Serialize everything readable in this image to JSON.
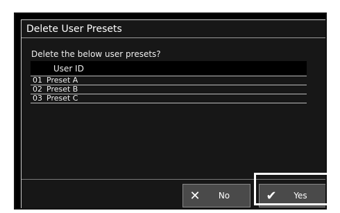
{
  "dialog": {
    "title": "Delete User Presets",
    "prompt": "Delete the below user presets?"
  },
  "table": {
    "header": "User ID",
    "rows": [
      {
        "num": "01",
        "name": "Preset A"
      },
      {
        "num": "02",
        "name": "Preset B"
      },
      {
        "num": "03",
        "name": "Preset C"
      }
    ]
  },
  "buttons": {
    "no": {
      "label": "No",
      "icon": "close-icon"
    },
    "yes": {
      "label": "Yes",
      "icon": "check-icon"
    }
  }
}
